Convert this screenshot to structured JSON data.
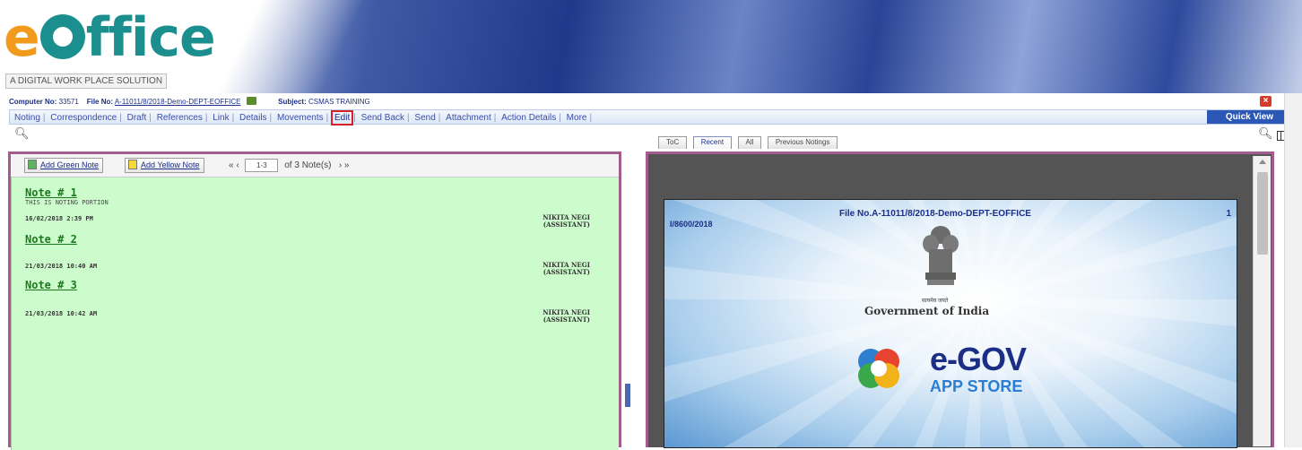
{
  "header": {
    "logo_text": "eOffice",
    "tagline": "A DIGITAL WORK PLACE SOLUTION"
  },
  "file_info": {
    "computer_no_label": "Computer No:",
    "computer_no": "33571",
    "file_no_label": "File No:",
    "file_no": "A-11011/8/2018-Demo-DEPT-EOFFICE",
    "subject_label": "Subject:",
    "subject": "CSMAS TRAINING"
  },
  "menu": {
    "items": [
      "Noting",
      "Correspondence",
      "Draft",
      "References",
      "Link",
      "Details",
      "Movements",
      "Edit",
      "Send Back",
      "Send",
      "Attachment",
      "Action Details",
      "More"
    ],
    "highlighted": "Edit",
    "quick_view": "Quick View"
  },
  "icons": {
    "left_search": "search-icon",
    "right_search": "search-icon",
    "columns": "columns-icon",
    "close": "close-icon",
    "file": "file-icon"
  },
  "tabs": {
    "items": [
      "ToC",
      "Recent",
      "All",
      "Previous Notings"
    ],
    "selected": "Recent"
  },
  "left_panel": {
    "add_green_note": "Add Green Note",
    "add_yellow_note": "Add Yellow Note",
    "pager_first": "« ‹",
    "pager_range": "1-3",
    "pager_total": "of 3 Note(s)",
    "pager_last": "› »",
    "notes": [
      {
        "title": "Note # 1",
        "subtitle": "THIS IS NOTING PORTION",
        "date": "16/02/2018 2:39 PM",
        "signer": "NIKITA NEGI",
        "role": "(ASSISTANT)"
      },
      {
        "title": "Note # 2",
        "subtitle": "",
        "date": "21/03/2018 10:40 AM",
        "signer": "NIKITA NEGI",
        "role": "(ASSISTANT)"
      },
      {
        "title": "Note # 3",
        "subtitle": "",
        "date": "21/03/2018 10:42 AM",
        "signer": "NIKITA NEGI",
        "role": "(ASSISTANT)"
      }
    ]
  },
  "document": {
    "file_no": "File No.A-11011/8/2018-Demo-DEPT-EOFFICE",
    "page_number": "1",
    "reference": "I/8600/2018",
    "emblem_caption": "सत्यमेव जयते",
    "gov_title": "Government of India",
    "egov_title": "e-GOV",
    "egov_subtitle": "APP STORE"
  },
  "colors": {
    "brand_teal": "#1a8f8e",
    "brand_orange": "#f29a1c",
    "panel_border": "#a35c8e",
    "notes_bg": "#ccfccc",
    "quick_view_bg": "#2d57b5",
    "highlight": "#d8202a"
  }
}
